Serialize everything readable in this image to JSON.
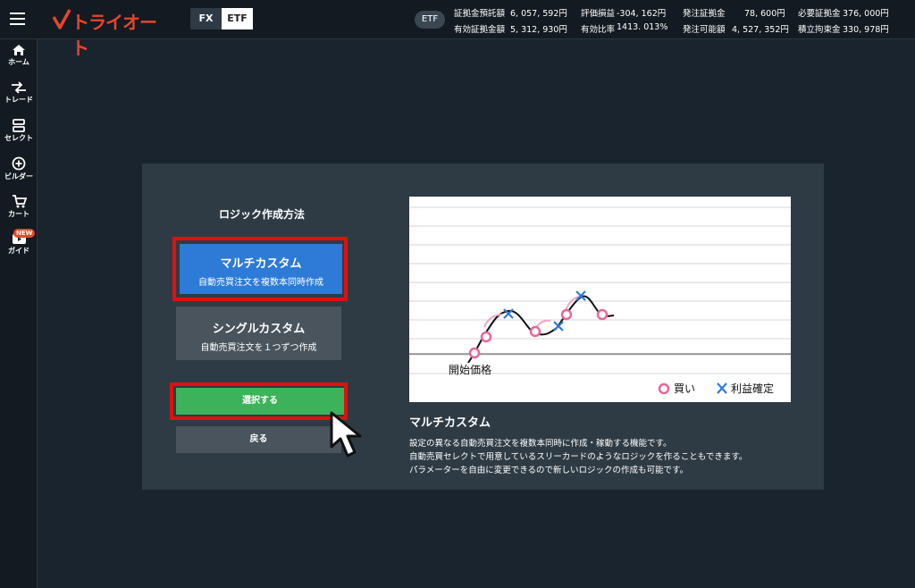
{
  "header": {
    "logo_text": "トライオート",
    "market_tabs": [
      "FX",
      "ETF"
    ],
    "active_market_badge": "ETF",
    "account": [
      {
        "label": "証拠金預託額",
        "value": "6, 057, 592円"
      },
      {
        "label": "評価損益",
        "value": "-304, 162円"
      },
      {
        "label": "発注証拠金",
        "value": "78, 600円"
      },
      {
        "label": "必要証拠金",
        "value": "376, 000円"
      },
      {
        "label": "有効証拠金額",
        "value": "5, 312, 930円"
      },
      {
        "label": "有効比率",
        "value": "1413. 013%"
      },
      {
        "label": "発注可能額",
        "value": "4, 527, 352円"
      },
      {
        "label": "積立拘束金",
        "value": "330, 978円"
      }
    ]
  },
  "sidebar": {
    "items": [
      {
        "label": "ホーム",
        "icon": "home-icon"
      },
      {
        "label": "トレード",
        "icon": "trade-arrows-icon"
      },
      {
        "label": "セレクト",
        "icon": "select-boxes-icon"
      },
      {
        "label": "ビルダー",
        "icon": "plus-circle-icon"
      },
      {
        "label": "カート",
        "icon": "cart-icon"
      },
      {
        "label": "ガイド",
        "icon": "video-guide-icon",
        "badge": "NEW"
      }
    ]
  },
  "panel": {
    "title": "ロジック作成方法",
    "options": [
      {
        "title": "マルチカスタム",
        "subtitle": "自動売買注文を複数本同時作成",
        "selected": true
      },
      {
        "title": "シングルカスタム",
        "subtitle": "自動売買注文を１つずつ作成",
        "selected": false
      }
    ],
    "select_button": "選択する",
    "back_button": "戻る",
    "chart": {
      "start_label": "開始価格",
      "legend_buy": "買い",
      "legend_profit": "利益確定"
    },
    "description": {
      "title": "マルチカスタム",
      "lines": [
        "設定の異なる自動売買注文を複数本同時に作成・稼動する機能です。",
        "自動売買セレクトで用意しているスリーカードのようなロジックを作ることもできます。",
        "パラメーターを自由に変更できるので新しいロジックの作成も可能です。"
      ]
    }
  },
  "colors": {
    "accent_blue": "#2d7bd6",
    "select_green": "#3cb25a",
    "highlight_red": "#e01010",
    "logo_red": "#e8452c",
    "buy_pink": "#e8669a",
    "profit_blue": "#2d7bd6"
  }
}
